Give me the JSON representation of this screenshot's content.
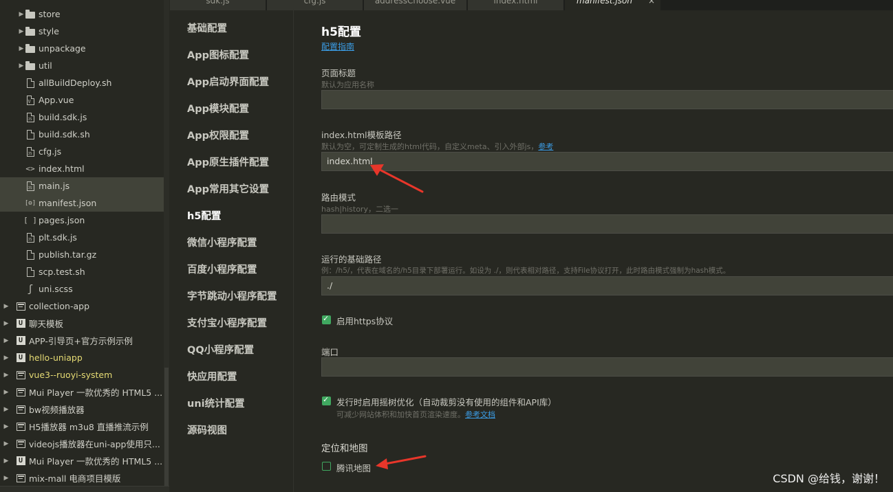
{
  "tree": {
    "items": [
      {
        "label": "store",
        "kind": "folder",
        "expandable": true
      },
      {
        "label": "style",
        "kind": "folder",
        "expandable": true
      },
      {
        "label": "unpackage",
        "kind": "folder",
        "expandable": true
      },
      {
        "label": "util",
        "kind": "folder",
        "expandable": true
      },
      {
        "label": "allBuildDeploy.sh",
        "kind": "file"
      },
      {
        "label": "App.vue",
        "kind": "vue"
      },
      {
        "label": "build.sdk.js",
        "kind": "js"
      },
      {
        "label": "build.sdk.sh",
        "kind": "file"
      },
      {
        "label": "cfg.js",
        "kind": "js"
      },
      {
        "label": "index.html",
        "kind": "html"
      },
      {
        "label": "main.js",
        "kind": "js",
        "selected": true
      },
      {
        "label": "manifest.json",
        "kind": "manifest",
        "selected": true
      },
      {
        "label": "pages.json",
        "kind": "json"
      },
      {
        "label": "plt.sdk.js",
        "kind": "js"
      },
      {
        "label": "publish.tar.gz",
        "kind": "file"
      },
      {
        "label": "scp.test.sh",
        "kind": "file"
      },
      {
        "label": "uni.scss",
        "kind": "scss"
      }
    ],
    "projects": [
      {
        "label": "collection-app",
        "kind": "project"
      },
      {
        "label": "聊天模板",
        "kind": "uni"
      },
      {
        "label": "APP-引导页+官方示例示例",
        "kind": "uni"
      },
      {
        "label": "hello-uniapp",
        "kind": "uni",
        "highlight": true
      },
      {
        "label": "vue3--ruoyi-system",
        "kind": "project",
        "highlight": true
      },
      {
        "label": "Mui Player 一款优秀的 HTML5 ...",
        "kind": "project"
      },
      {
        "label": "bw视频播放器",
        "kind": "project"
      },
      {
        "label": "H5播放器  m3u8 直播推流示例",
        "kind": "project"
      },
      {
        "label": "videojs播放器在uni-app使用只...",
        "kind": "project"
      },
      {
        "label": "Mui Player 一款优秀的 HTML5 ...",
        "kind": "uni"
      },
      {
        "label": "mix-mall 电商项目模版",
        "kind": "project"
      }
    ]
  },
  "tabs": [
    {
      "label": "sdk.js"
    },
    {
      "label": "cfg.js"
    },
    {
      "label": "addressChoose.vue"
    },
    {
      "label": "index.html"
    },
    {
      "label": "manifest.json",
      "active": true,
      "close": "×"
    }
  ],
  "nav": {
    "items": [
      "基础配置",
      "App图标配置",
      "App启动界面配置",
      "App模块配置",
      "App权限配置",
      "App原生插件配置",
      "App常用其它设置",
      "h5配置",
      "微信小程序配置",
      "百度小程序配置",
      "字节跳动小程序配置",
      "支付宝小程序配置",
      "QQ小程序配置",
      "快应用配置",
      "uni统计配置",
      "源码视图"
    ],
    "active_index": 7
  },
  "form": {
    "title": "h5配置",
    "guide_link": "配置指南",
    "page_title": {
      "label": "页面标题",
      "hint": "默认为应用名称",
      "value": ""
    },
    "template_path": {
      "label": "index.html模板路径",
      "hint": "默认为空，可定制生成的html代码，自定义meta、引入外部js，",
      "hint_link": "参考",
      "value": "index.html"
    },
    "router_mode": {
      "label": "路由模式",
      "hint": "hash|history，二选一",
      "value": ""
    },
    "base_path": {
      "label": "运行的基础路径",
      "hint": "例：/h5/，代表在域名的/h5目录下部署运行。如设为 ./，则代表相对路径，支持File协议打开，此时路由模式强制为hash模式。",
      "value": "./"
    },
    "https": {
      "label": "启用https协议",
      "checked": true
    },
    "port": {
      "label": "端口",
      "value": ""
    },
    "tree_shaking": {
      "label": "发行时启用摇树优化（自动裁剪没有使用的组件和API库）",
      "hint": "可减少网站体积和加快首页渲染速度。",
      "hint_link": "参考文档",
      "checked": true
    },
    "location_section": "定位和地图",
    "tencent_map": {
      "label": "腾讯地图",
      "checked": false
    }
  },
  "watermark": "CSDN @给钱，谢谢！",
  "colors": {
    "background": "#272822",
    "accent": "#40a860",
    "link": "#3b9de6",
    "annotation_arrow": "#e8362a"
  }
}
